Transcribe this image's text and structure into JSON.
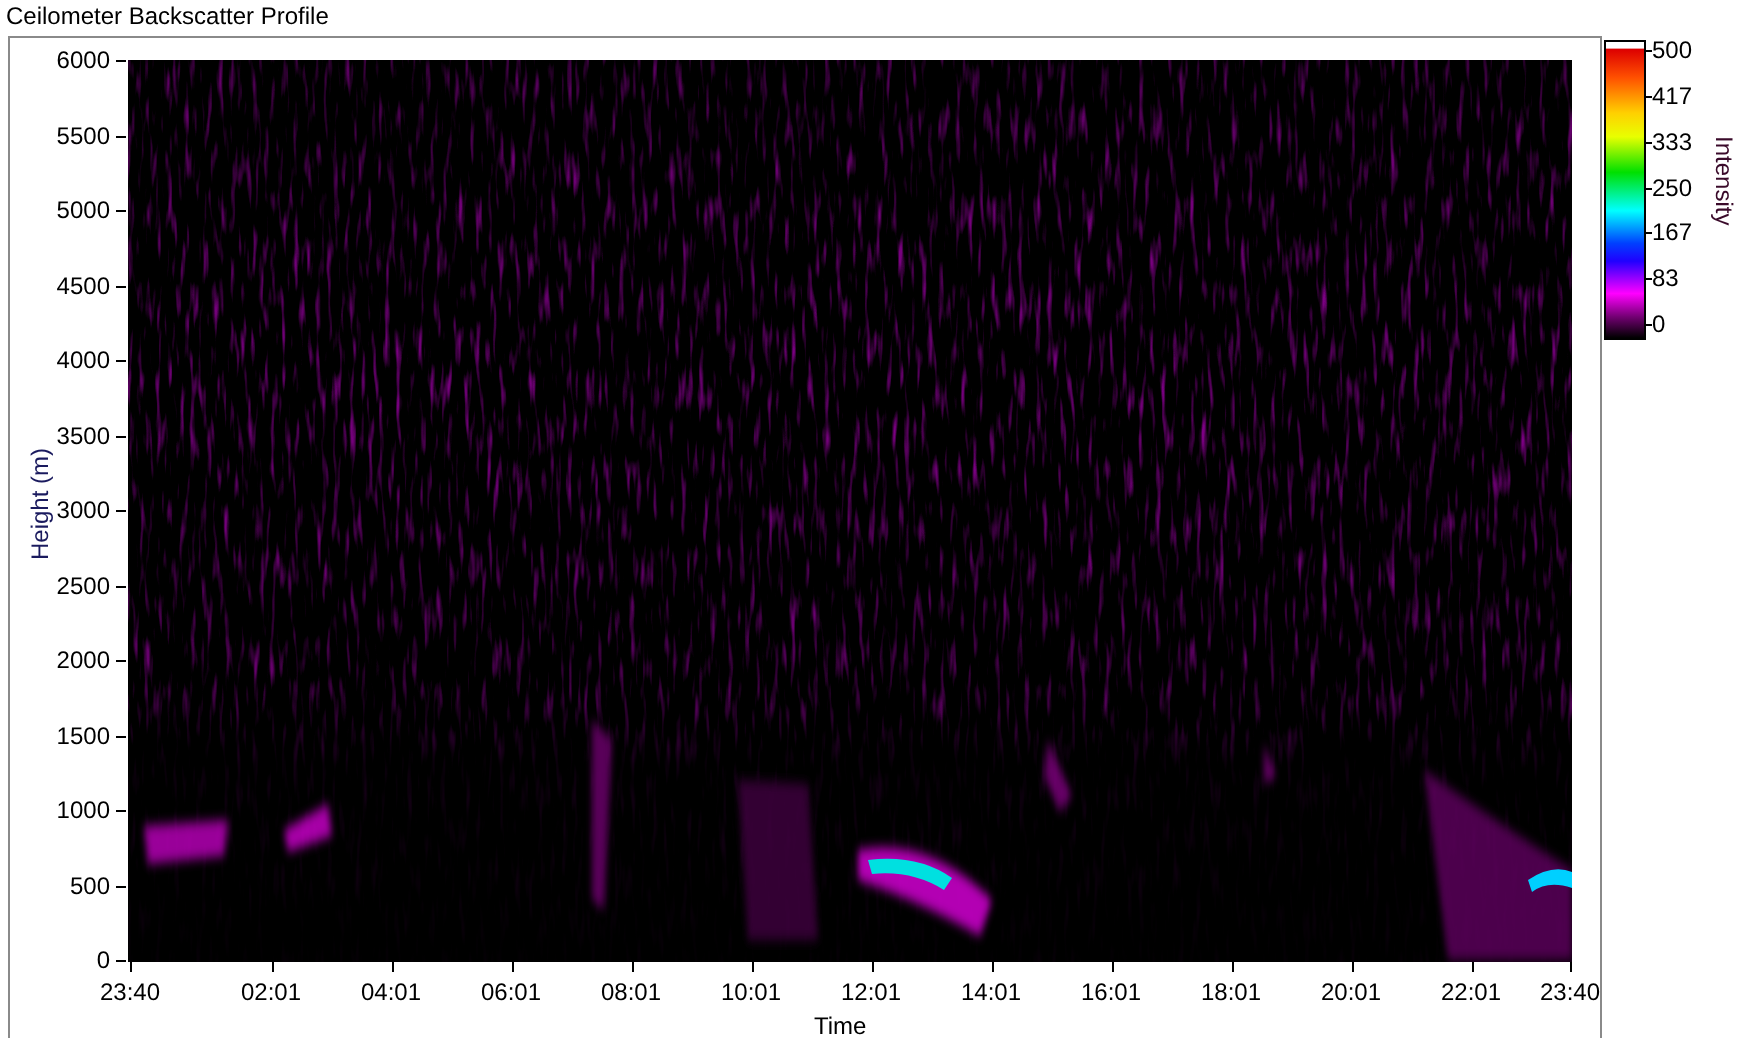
{
  "title": "Ceilometer Backscatter Profile",
  "plot": {
    "y_label": "Height (m)",
    "y_ticks": [
      "6000",
      "5500",
      "5000",
      "4500",
      "4000",
      "3500",
      "3000",
      "2500",
      "2000",
      "1500",
      "1000",
      "500",
      "0"
    ],
    "x_label": "Time",
    "x_ticks": [
      "23:40",
      "02:01",
      "04:01",
      "06:01",
      "08:01",
      "10:01",
      "12:01",
      "14:01",
      "16:01",
      "18:01",
      "20:01",
      "22:01",
      "23:40"
    ]
  },
  "color_scale": {
    "label": "Intensity",
    "ticks": [
      "500",
      "417",
      "333",
      "250",
      "167",
      "83",
      "0"
    ]
  }
}
